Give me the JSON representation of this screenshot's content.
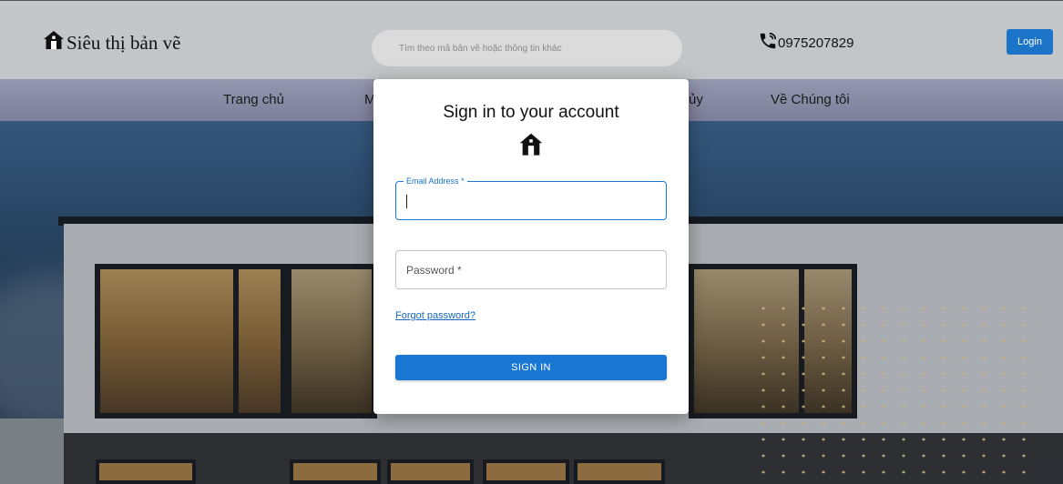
{
  "header": {
    "brand": "Siêu thị bản vẽ",
    "search_placeholder": "Tìm theo mã bản vẽ hoặc thông tin khác",
    "phone": "0975207829",
    "login_label": "Login"
  },
  "nav": {
    "items": [
      {
        "label": "Trang chủ"
      },
      {
        "label": "M"
      },
      {
        "label": "ủy"
      },
      {
        "label": "Về Chúng tôi"
      }
    ]
  },
  "modal": {
    "title": "Sign in to your account",
    "email_label": "Email Address *",
    "email_value": "",
    "password_label": "Password *",
    "forgot_label": "Forgot password?",
    "submit_label": "SIGN IN"
  },
  "colors": {
    "accent": "#1976d2",
    "login_button": "#1b74c7"
  },
  "icons": {
    "brand": "house-icon",
    "phone": "phone-icon",
    "modal": "house-icon"
  }
}
